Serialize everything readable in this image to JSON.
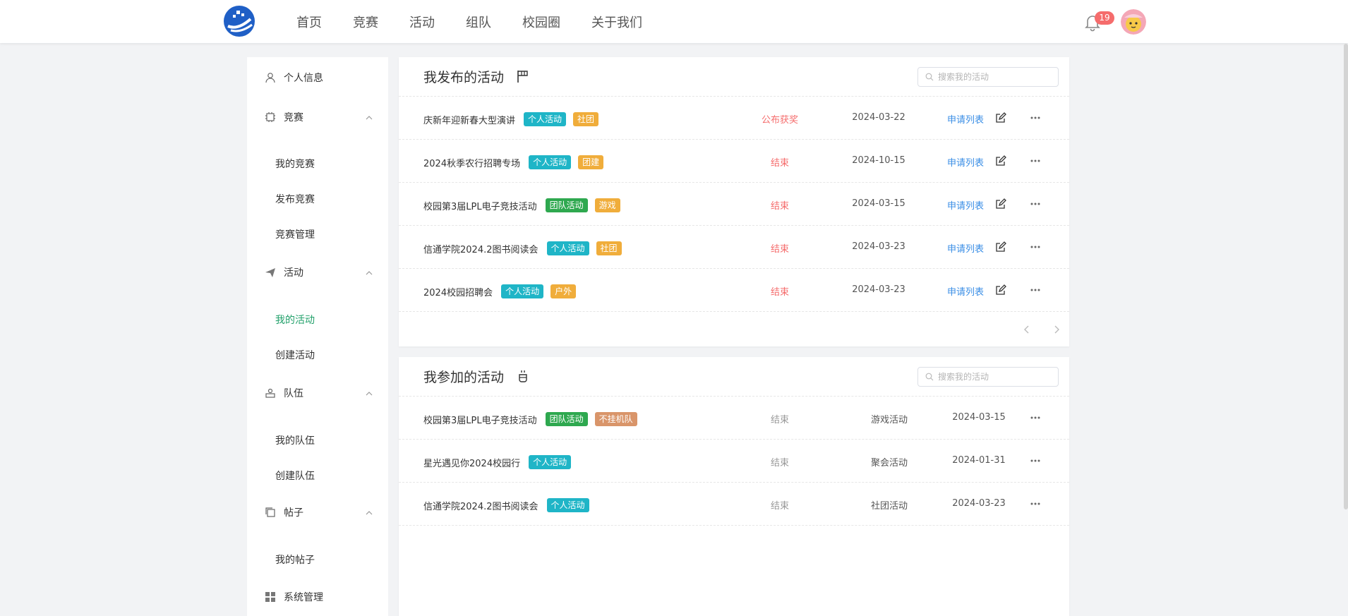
{
  "nav": {
    "items": [
      "首页",
      "竞赛",
      "活动",
      "组队",
      "校园圈",
      "关于我们"
    ],
    "notification_count": "19"
  },
  "sidebar": {
    "profile": "个人信息",
    "competition": {
      "label": "竞赛",
      "items": [
        "我的竞赛",
        "发布竞赛",
        "竞赛管理"
      ]
    },
    "activity": {
      "label": "活动",
      "items": [
        "我的活动",
        "创建活动"
      ]
    },
    "team": {
      "label": "队伍",
      "items": [
        "我的队伍",
        "创建队伍"
      ]
    },
    "post": {
      "label": "帖子",
      "items": [
        "我的帖子"
      ]
    },
    "admin": "系统管理"
  },
  "published": {
    "title": "我发布的活动",
    "search_placeholder": "搜索我的活动",
    "rows": [
      {
        "name": "庆新年迎新春大型演讲",
        "tags": [
          {
            "text": "个人活动",
            "color": "blue"
          },
          {
            "text": "社团",
            "color": "orange"
          }
        ],
        "status": "公布获奖",
        "date": "2024-03-22",
        "link": "申请列表"
      },
      {
        "name": "2024秋季农行招聘专场",
        "tags": [
          {
            "text": "个人活动",
            "color": "blue"
          },
          {
            "text": "团建",
            "color": "orange"
          }
        ],
        "status": "结束",
        "date": "2024-10-15",
        "link": "申请列表"
      },
      {
        "name": "校园第3届LPL电子竞技活动",
        "tags": [
          {
            "text": "团队活动",
            "color": "green"
          },
          {
            "text": "游戏",
            "color": "orange"
          }
        ],
        "status": "结束",
        "date": "2024-03-15",
        "link": "申请列表"
      },
      {
        "name": "信通学院2024.2图书阅读会",
        "tags": [
          {
            "text": "个人活动",
            "color": "blue"
          },
          {
            "text": "社团",
            "color": "orange"
          }
        ],
        "status": "结束",
        "date": "2024-03-23",
        "link": "申请列表"
      },
      {
        "name": "2024校园招聘会",
        "tags": [
          {
            "text": "个人活动",
            "color": "blue"
          },
          {
            "text": "户外",
            "color": "orange"
          }
        ],
        "status": "结束",
        "date": "2024-03-23",
        "link": "申请列表"
      }
    ]
  },
  "joined": {
    "title": "我参加的活动",
    "search_placeholder": "搜索我的活动",
    "rows": [
      {
        "name": "校园第3届LPL电子竞技活动",
        "tags": [
          {
            "text": "团队活动",
            "color": "green"
          },
          {
            "text": "不挂机队",
            "color": "tan"
          }
        ],
        "status": "结束",
        "kind": "游戏活动",
        "date": "2024-03-15"
      },
      {
        "name": "星光遇见你2024校园行",
        "tags": [
          {
            "text": "个人活动",
            "color": "blue"
          }
        ],
        "status": "结束",
        "kind": "聚会活动",
        "date": "2024-01-31"
      },
      {
        "name": "信通学院2024.2图书阅读会",
        "tags": [
          {
            "text": "个人活动",
            "color": "blue"
          }
        ],
        "status": "结束",
        "kind": "社团活动",
        "date": "2024-03-23"
      }
    ]
  }
}
